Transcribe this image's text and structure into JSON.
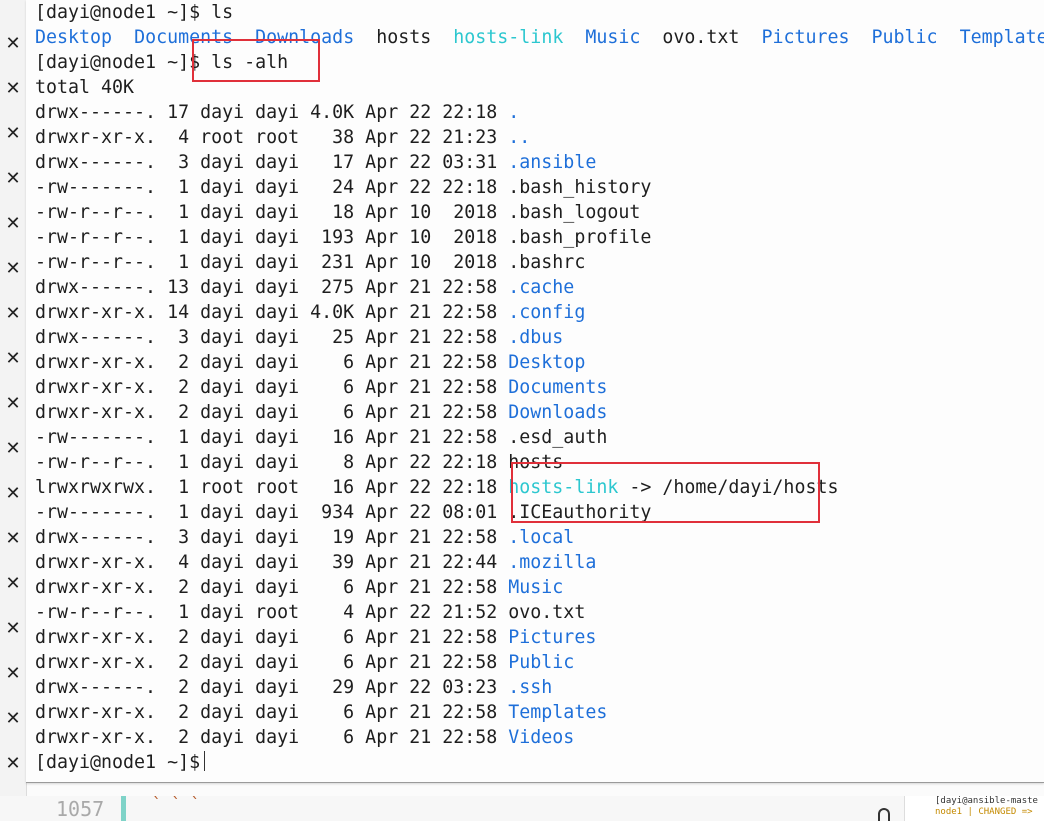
{
  "colors": {
    "directory": "#1e6fd9",
    "symlink": "#2cc7cf",
    "text": "#1e1e1e",
    "highlight_box": "#e0303a"
  },
  "gutter_icon": "close-icon",
  "gutter_glyph": "✕",
  "terminal": {
    "ls_prompt": "[dayi@node1 ~]$ ls",
    "ls_output": [
      {
        "name": "Desktop",
        "type": "dir"
      },
      {
        "name": "Documents",
        "type": "dir"
      },
      {
        "name": "Downloads",
        "type": "dir"
      },
      {
        "name": "hosts",
        "type": "file"
      },
      {
        "name": "hosts-link",
        "type": "link"
      },
      {
        "name": "Music",
        "type": "dir"
      },
      {
        "name": "ovo.txt",
        "type": "file"
      },
      {
        "name": "Pictures",
        "type": "dir"
      },
      {
        "name": "Public",
        "type": "dir"
      },
      {
        "name": "Templates",
        "type": "dir"
      }
    ],
    "alh_prompt_user": "[dayi@node1 ~]$",
    "alh_command": "ls -alh",
    "total_line": "total 40K",
    "entries": [
      {
        "perms": "drwx------.",
        "links": "17",
        "owner": "dayi",
        "group": "dayi",
        "size": "4.0K",
        "month": "Apr",
        "day": "22",
        "time": "22:18",
        "name": ".",
        "type": "dir"
      },
      {
        "perms": "drwxr-xr-x.",
        "links": "4",
        "owner": "root",
        "group": "root",
        "size": "38",
        "month": "Apr",
        "day": "22",
        "time": "21:23",
        "name": "..",
        "type": "dir"
      },
      {
        "perms": "drwx------.",
        "links": "3",
        "owner": "dayi",
        "group": "dayi",
        "size": "17",
        "month": "Apr",
        "day": "22",
        "time": "03:31",
        "name": ".ansible",
        "type": "dir"
      },
      {
        "perms": "-rw-------.",
        "links": "1",
        "owner": "dayi",
        "group": "dayi",
        "size": "24",
        "month": "Apr",
        "day": "22",
        "time": "22:18",
        "name": ".bash_history",
        "type": "file"
      },
      {
        "perms": "-rw-r--r--.",
        "links": "1",
        "owner": "dayi",
        "group": "dayi",
        "size": "18",
        "month": "Apr",
        "day": "10",
        "time": "2018",
        "name": ".bash_logout",
        "type": "file"
      },
      {
        "perms": "-rw-r--r--.",
        "links": "1",
        "owner": "dayi",
        "group": "dayi",
        "size": "193",
        "month": "Apr",
        "day": "10",
        "time": "2018",
        "name": ".bash_profile",
        "type": "file"
      },
      {
        "perms": "-rw-r--r--.",
        "links": "1",
        "owner": "dayi",
        "group": "dayi",
        "size": "231",
        "month": "Apr",
        "day": "10",
        "time": "2018",
        "name": ".bashrc",
        "type": "file"
      },
      {
        "perms": "drwx------.",
        "links": "13",
        "owner": "dayi",
        "group": "dayi",
        "size": "275",
        "month": "Apr",
        "day": "21",
        "time": "22:58",
        "name": ".cache",
        "type": "dir"
      },
      {
        "perms": "drwxr-xr-x.",
        "links": "14",
        "owner": "dayi",
        "group": "dayi",
        "size": "4.0K",
        "month": "Apr",
        "day": "21",
        "time": "22:58",
        "name": ".config",
        "type": "dir"
      },
      {
        "perms": "drwx------.",
        "links": "3",
        "owner": "dayi",
        "group": "dayi",
        "size": "25",
        "month": "Apr",
        "day": "21",
        "time": "22:58",
        "name": ".dbus",
        "type": "dir"
      },
      {
        "perms": "drwxr-xr-x.",
        "links": "2",
        "owner": "dayi",
        "group": "dayi",
        "size": "6",
        "month": "Apr",
        "day": "21",
        "time": "22:58",
        "name": "Desktop",
        "type": "dir"
      },
      {
        "perms": "drwxr-xr-x.",
        "links": "2",
        "owner": "dayi",
        "group": "dayi",
        "size": "6",
        "month": "Apr",
        "day": "21",
        "time": "22:58",
        "name": "Documents",
        "type": "dir"
      },
      {
        "perms": "drwxr-xr-x.",
        "links": "2",
        "owner": "dayi",
        "group": "dayi",
        "size": "6",
        "month": "Apr",
        "day": "21",
        "time": "22:58",
        "name": "Downloads",
        "type": "dir"
      },
      {
        "perms": "-rw-------.",
        "links": "1",
        "owner": "dayi",
        "group": "dayi",
        "size": "16",
        "month": "Apr",
        "day": "21",
        "time": "22:58",
        "name": ".esd_auth",
        "type": "file"
      },
      {
        "perms": "-rw-r--r--.",
        "links": "1",
        "owner": "dayi",
        "group": "dayi",
        "size": "8",
        "month": "Apr",
        "day": "22",
        "time": "22:18",
        "name": "hosts",
        "type": "file"
      },
      {
        "perms": "lrwxrwxrwx.",
        "links": "1",
        "owner": "root",
        "group": "root",
        "size": "16",
        "month": "Apr",
        "day": "22",
        "time": "22:18",
        "name": "hosts-link",
        "type": "link",
        "target": " -> /home/dayi/hosts"
      },
      {
        "perms": "-rw-------.",
        "links": "1",
        "owner": "dayi",
        "group": "dayi",
        "size": "934",
        "month": "Apr",
        "day": "22",
        "time": "08:01",
        "name": ".ICEauthority",
        "type": "file"
      },
      {
        "perms": "drwx------.",
        "links": "3",
        "owner": "dayi",
        "group": "dayi",
        "size": "19",
        "month": "Apr",
        "day": "21",
        "time": "22:58",
        "name": ".local",
        "type": "dir"
      },
      {
        "perms": "drwxr-xr-x.",
        "links": "4",
        "owner": "dayi",
        "group": "dayi",
        "size": "39",
        "month": "Apr",
        "day": "21",
        "time": "22:44",
        "name": ".mozilla",
        "type": "dir"
      },
      {
        "perms": "drwxr-xr-x.",
        "links": "2",
        "owner": "dayi",
        "group": "dayi",
        "size": "6",
        "month": "Apr",
        "day": "21",
        "time": "22:58",
        "name": "Music",
        "type": "dir"
      },
      {
        "perms": "-rw-r--r--.",
        "links": "1",
        "owner": "dayi",
        "group": "root",
        "size": "4",
        "month": "Apr",
        "day": "22",
        "time": "21:52",
        "name": "ovo.txt",
        "type": "file"
      },
      {
        "perms": "drwxr-xr-x.",
        "links": "2",
        "owner": "dayi",
        "group": "dayi",
        "size": "6",
        "month": "Apr",
        "day": "21",
        "time": "22:58",
        "name": "Pictures",
        "type": "dir"
      },
      {
        "perms": "drwxr-xr-x.",
        "links": "2",
        "owner": "dayi",
        "group": "dayi",
        "size": "6",
        "month": "Apr",
        "day": "21",
        "time": "22:58",
        "name": "Public",
        "type": "dir"
      },
      {
        "perms": "drwx------.",
        "links": "2",
        "owner": "dayi",
        "group": "dayi",
        "size": "29",
        "month": "Apr",
        "day": "22",
        "time": "03:23",
        "name": ".ssh",
        "type": "dir"
      },
      {
        "perms": "drwxr-xr-x.",
        "links": "2",
        "owner": "dayi",
        "group": "dayi",
        "size": "6",
        "month": "Apr",
        "day": "21",
        "time": "22:58",
        "name": "Templates",
        "type": "dir"
      },
      {
        "perms": "drwxr-xr-x.",
        "links": "2",
        "owner": "dayi",
        "group": "dayi",
        "size": "6",
        "month": "Apr",
        "day": "21",
        "time": "22:58",
        "name": "Videos",
        "type": "dir"
      }
    ],
    "final_prompt": "[dayi@node1 ~]$"
  },
  "editor_strip": {
    "line_number": "1057",
    "code_fragment": "` ` `",
    "mini_terminal_line1": "[dayi@ansible-maste",
    "mini_terminal_line2": "node1 | CHANGED =>"
  }
}
